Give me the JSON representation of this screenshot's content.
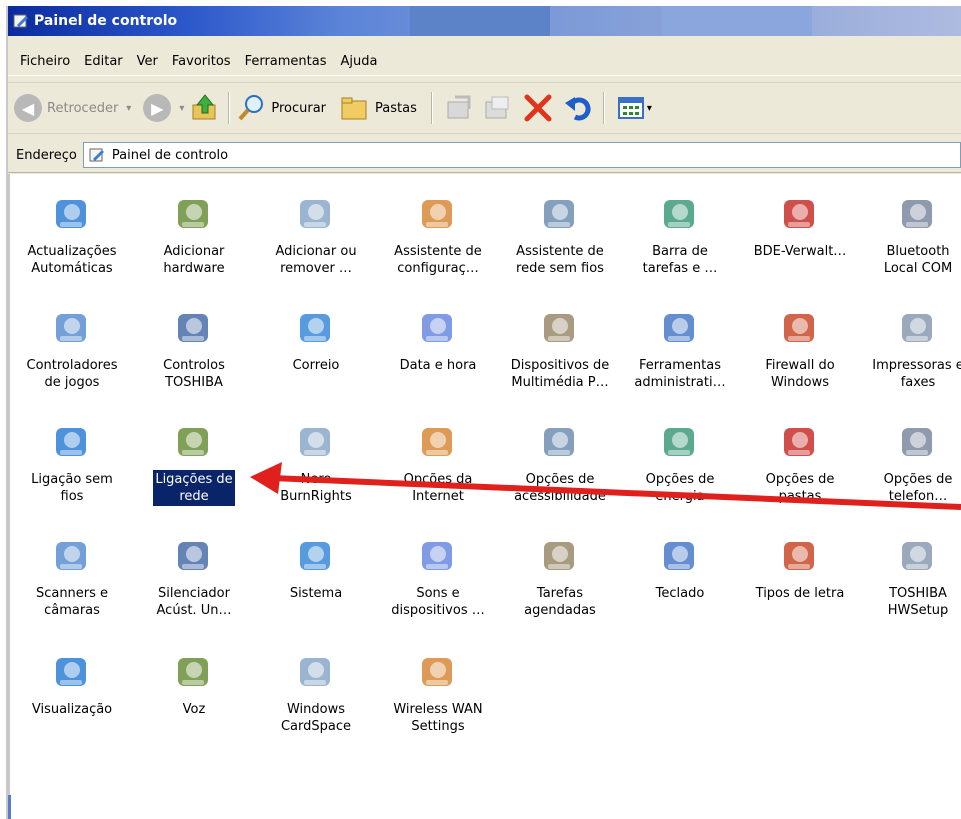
{
  "window": {
    "title": "Painel de controlo"
  },
  "menu": [
    "Ficheiro",
    "Editar",
    "Ver",
    "Favoritos",
    "Ferramentas",
    "Ajuda"
  ],
  "toolbar": {
    "back_label": "Retroceder",
    "search_label": "Procurar",
    "folders_label": "Pastas"
  },
  "address": {
    "label": "Endereço",
    "value": "Painel de controlo"
  },
  "colors": {
    "selection": "#0a246a",
    "arrow": "#e0201c",
    "titlebar": "#0a2b9e"
  },
  "items": [
    {
      "label": "Actualizações\nAutomáticas",
      "icon": "windows-update-icon"
    },
    {
      "label": "Adicionar\nhardware",
      "icon": "add-hardware-icon"
    },
    {
      "label": "Adicionar ou\nremover …",
      "icon": "add-remove-programs-icon"
    },
    {
      "label": "Assistente de\nconfiguraç…",
      "icon": "network-setup-icon"
    },
    {
      "label": "Assistente de\nrede sem fios",
      "icon": "wireless-setup-icon"
    },
    {
      "label": "Barra de\ntarefas e …",
      "icon": "taskbar-icon"
    },
    {
      "label": "BDE-Verwalt…",
      "icon": "bde-admin-icon"
    },
    {
      "label": "Bluetooth\nLocal COM",
      "icon": "bluetooth-icon"
    },
    {
      "label": "Controladores\nde jogos",
      "icon": "game-controller-icon"
    },
    {
      "label": "Controlos\nTOSHIBA",
      "icon": "toshiba-controls-icon"
    },
    {
      "label": "Correio",
      "icon": "mail-icon"
    },
    {
      "label": "Data e hora",
      "icon": "date-time-icon"
    },
    {
      "label": "Dispositivos de\nMultimédia P…",
      "icon": "portable-media-icon"
    },
    {
      "label": "Ferramentas\nadministrati…",
      "icon": "admin-tools-icon"
    },
    {
      "label": "Firewall do\nWindows",
      "icon": "firewall-icon"
    },
    {
      "label": "Impressoras e\nfaxes",
      "icon": "printer-icon"
    },
    {
      "label": "Ligação sem\nfios",
      "icon": "wireless-connection-icon"
    },
    {
      "label": "Ligações de\nrede",
      "icon": "network-connections-icon",
      "selected": true
    },
    {
      "label": "Nero\nBurnRights",
      "icon": "nero-icon"
    },
    {
      "label": "Opções da\nInternet",
      "icon": "internet-options-icon"
    },
    {
      "label": "Opções de\nacessibilidade",
      "icon": "accessibility-icon"
    },
    {
      "label": "Opções de\nenergia",
      "icon": "power-options-icon"
    },
    {
      "label": "Opções de\npastas",
      "icon": "folder-options-icon"
    },
    {
      "label": "Opções de\ntelefon…",
      "icon": "phone-options-icon"
    },
    {
      "label": "Scanners e\ncâmaras",
      "icon": "scanner-icon"
    },
    {
      "label": "Silenciador\nAcúst. Un…",
      "icon": "cd-silencer-icon"
    },
    {
      "label": "Sistema",
      "icon": "system-icon"
    },
    {
      "label": "Sons e\ndispositivos …",
      "icon": "sounds-icon"
    },
    {
      "label": "Tarefas\nagendadas",
      "icon": "scheduled-tasks-icon"
    },
    {
      "label": "Teclado",
      "icon": "keyboard-icon"
    },
    {
      "label": "Tipos de letra",
      "icon": "fonts-icon"
    },
    {
      "label": "TOSHIBA\nHWSetup",
      "icon": "toshiba-hwsetup-icon"
    },
    {
      "label": "Visualização",
      "icon": "display-icon"
    },
    {
      "label": "Voz",
      "icon": "speech-icon"
    },
    {
      "label": "Windows\nCardSpace",
      "icon": "cardspace-icon"
    },
    {
      "label": "Wireless WAN\nSettings",
      "icon": "wireless-wan-icon"
    }
  ]
}
